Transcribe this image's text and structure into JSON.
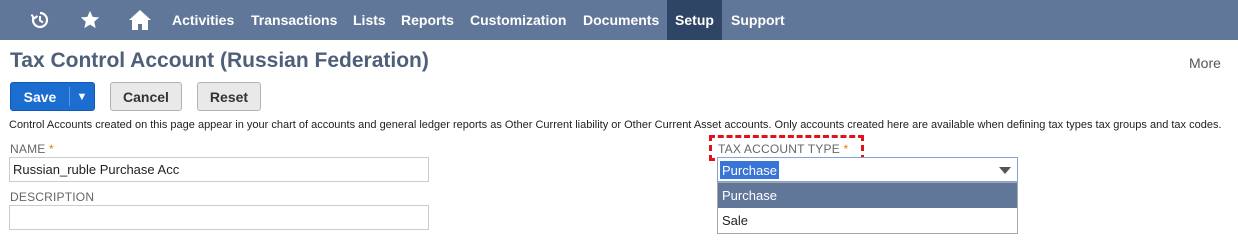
{
  "nav": {
    "icons": [
      "recent-icon",
      "star-icon",
      "home-icon"
    ],
    "menu": [
      "Activities",
      "Transactions",
      "Lists",
      "Reports",
      "Customization",
      "Documents",
      "Setup",
      "Support"
    ],
    "active": "Setup"
  },
  "page": {
    "title": "Tax Control Account (Russian Federation)",
    "more_label": "More",
    "description": "Control Accounts created on this page appear in your chart of accounts and general ledger reports as Other Current liability or Other Current Asset accounts. Only accounts created here are available when defining tax types tax groups and tax codes."
  },
  "toolbar": {
    "save_label": "Save",
    "save_drop_glyph": "▼",
    "cancel_label": "Cancel",
    "reset_label": "Reset"
  },
  "form": {
    "name_label": "NAME",
    "name_value": "Russian_ruble Purchase Acc",
    "description_label": "DESCRIPTION",
    "description_value": "",
    "tax_type_label": "TAX ACCOUNT TYPE",
    "required_mark": "*",
    "tax_type_value": "Purchase",
    "tax_type_options": [
      "Purchase",
      "Sale"
    ]
  },
  "colors": {
    "nav_bg": "#607799",
    "nav_active": "#2f4565",
    "save_blue": "#1c6dd0",
    "required": "#e07d00",
    "highlight_red": "#e0131a"
  }
}
